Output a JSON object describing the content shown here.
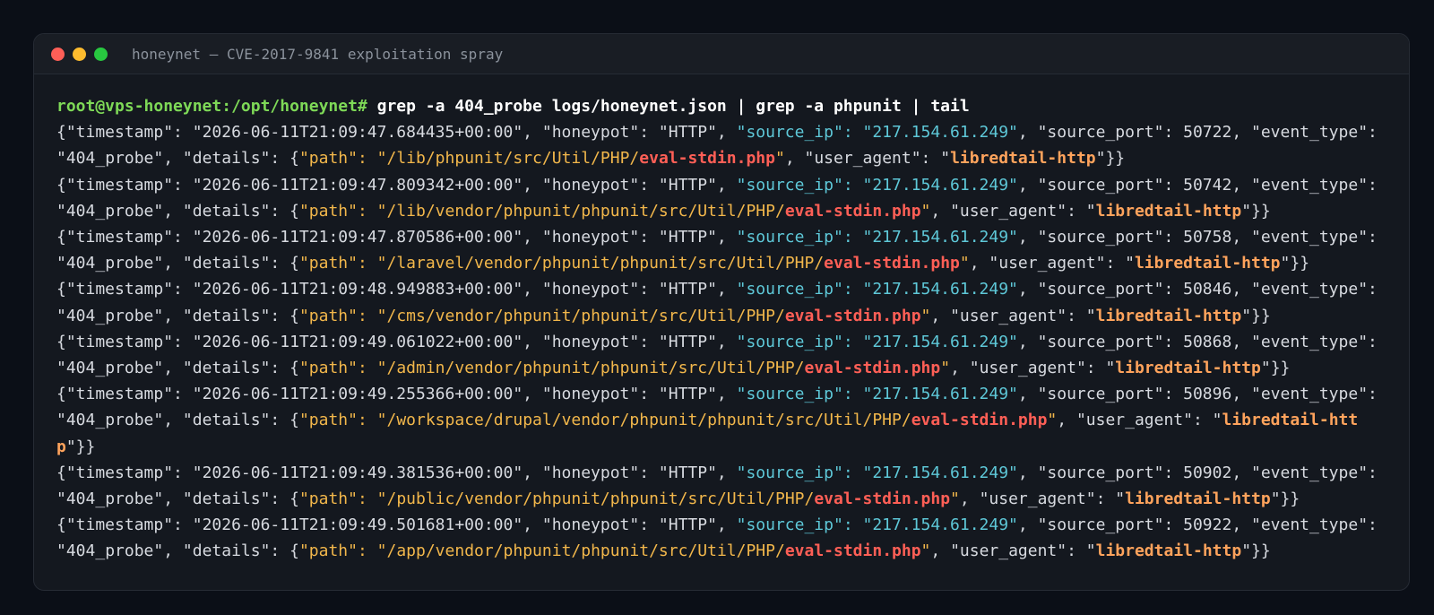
{
  "window": {
    "title": "honeynet — CVE-2017-9841 exploitation spray"
  },
  "terminal": {
    "prompt": "root@vps-honeynet:/opt/honeynet#",
    "command": "grep -a 404_probe logs/honeynet.json | grep -a phpunit | tail",
    "entries": [
      {
        "timestamp": "2026-06-11T21:09:47.684435+00:00",
        "honeypot": "HTTP",
        "source_ip": "217.154.61.249",
        "source_port": "50722",
        "event_type": "404_probe",
        "path_prefix": "/lib/phpunit/src/Util/PHP/",
        "path_file": "eval-stdin.php",
        "user_agent": "libredtail-http"
      },
      {
        "timestamp": "2026-06-11T21:09:47.809342+00:00",
        "honeypot": "HTTP",
        "source_ip": "217.154.61.249",
        "source_port": "50742",
        "event_type": "404_probe",
        "path_prefix": "/lib/vendor/phpunit/phpunit/src/Util/PHP/",
        "path_file": "eval-stdin.php",
        "user_agent": "libredtail-http"
      },
      {
        "timestamp": "2026-06-11T21:09:47.870586+00:00",
        "honeypot": "HTTP",
        "source_ip": "217.154.61.249",
        "source_port": "50758",
        "event_type": "404_probe",
        "path_prefix": "/laravel/vendor/phpunit/phpunit/src/Util/PHP/",
        "path_file": "eval-stdin.php",
        "user_agent": "libredtail-http"
      },
      {
        "timestamp": "2026-06-11T21:09:48.949883+00:00",
        "honeypot": "HTTP",
        "source_ip": "217.154.61.249",
        "source_port": "50846",
        "event_type": "404_probe",
        "path_prefix": "/cms/vendor/phpunit/phpunit/src/Util/PHP/",
        "path_file": "eval-stdin.php",
        "user_agent": "libredtail-http"
      },
      {
        "timestamp": "2026-06-11T21:09:49.061022+00:00",
        "honeypot": "HTTP",
        "source_ip": "217.154.61.249",
        "source_port": "50868",
        "event_type": "404_probe",
        "path_prefix": "/admin/vendor/phpunit/phpunit/src/Util/PHP/",
        "path_file": "eval-stdin.php",
        "user_agent": "libredtail-http"
      },
      {
        "timestamp": "2026-06-11T21:09:49.255366+00:00",
        "honeypot": "HTTP",
        "source_ip": "217.154.61.249",
        "source_port": "50896",
        "event_type": "404_probe",
        "path_prefix": "/workspace/drupal/vendor/phpunit/phpunit/src/Util/PHP/",
        "path_file": "eval-stdin.php",
        "user_agent": "libredtail-http"
      },
      {
        "timestamp": "2026-06-11T21:09:49.381536+00:00",
        "honeypot": "HTTP",
        "source_ip": "217.154.61.249",
        "source_port": "50902",
        "event_type": "404_probe",
        "path_prefix": "/public/vendor/phpunit/phpunit/src/Util/PHP/",
        "path_file": "eval-stdin.php",
        "user_agent": "libredtail-http"
      },
      {
        "timestamp": "2026-06-11T21:09:49.501681+00:00",
        "honeypot": "HTTP",
        "source_ip": "217.154.61.249",
        "source_port": "50922",
        "event_type": "404_probe",
        "path_prefix": "/app/vendor/phpunit/phpunit/src/Util/PHP/",
        "path_file": "eval-stdin.php",
        "user_agent": "libredtail-http"
      }
    ]
  },
  "colors": {
    "background": "#0b0f17",
    "window": "#14181f",
    "prompt": "#7ed957",
    "source_ip_key": "#5ec8d8",
    "path": "#f2b74b",
    "filename": "#ff5f56",
    "user_agent": "#ffa35c"
  }
}
